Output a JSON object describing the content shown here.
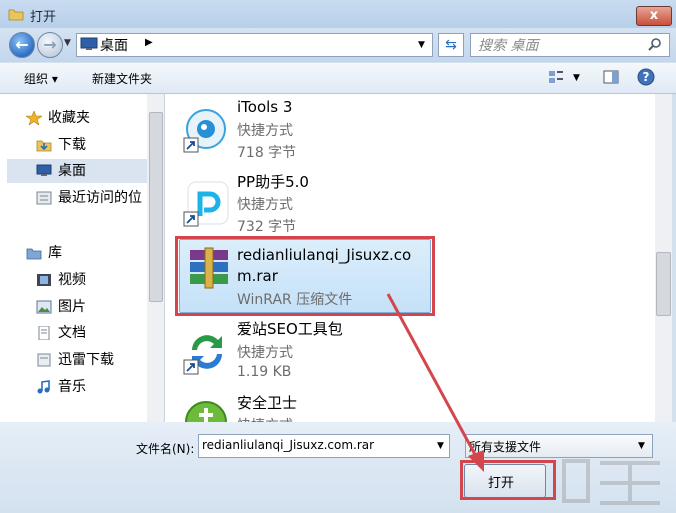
{
  "window": {
    "title": "打开",
    "close_symbol": "x"
  },
  "nav": {
    "address": "桌面",
    "search_placeholder": "搜索 桌面"
  },
  "toolbar": {
    "organize": "组织 ▾",
    "new_folder": "新建文件夹"
  },
  "sidebar": {
    "items": [
      {
        "label": "收藏夹",
        "icon": "star-icon"
      },
      {
        "label": "下载",
        "icon": "download-folder-icon"
      },
      {
        "label": "桌面",
        "icon": "desktop-icon",
        "selected": true
      },
      {
        "label": "最近访问的位",
        "icon": "recent-icon"
      },
      {
        "label": "库",
        "icon": "library-icon"
      },
      {
        "label": "视频",
        "icon": "video-icon"
      },
      {
        "label": "图片",
        "icon": "picture-icon"
      },
      {
        "label": "文档",
        "icon": "document-icon"
      },
      {
        "label": "迅雷下载",
        "icon": "thunder-folder-icon"
      },
      {
        "label": "音乐",
        "icon": "music-icon"
      }
    ]
  },
  "files": [
    {
      "name": "iTools 3",
      "type": "快捷方式",
      "size": "718 字节",
      "icon": "itools-icon"
    },
    {
      "name": "PP助手5.0",
      "type": "快捷方式",
      "size": "732 字节",
      "icon": "pp-assistant-icon"
    },
    {
      "name_line1": "redianliulanqi_Jisuxz.co",
      "name_line2": "m.rar",
      "type": "WinRAR 压缩文件",
      "icon": "winrar-icon",
      "selected": true
    },
    {
      "name": "爱站SEO工具包",
      "type": "快捷方式",
      "size": "1.19 KB",
      "icon": "aizhan-icon"
    },
    {
      "name": "安全卫士",
      "type": "快捷方式",
      "icon": "360-safe-icon"
    }
  ],
  "bottom": {
    "filename_label": "文件名(N):",
    "filename_value": "redianliulanqi_Jisuxz.com.rar",
    "filetype_value": "所有支援文件",
    "open_label": "打开"
  },
  "colors": {
    "highlight_red": "#d3474c",
    "selection_blue": "#c5e1f8"
  }
}
